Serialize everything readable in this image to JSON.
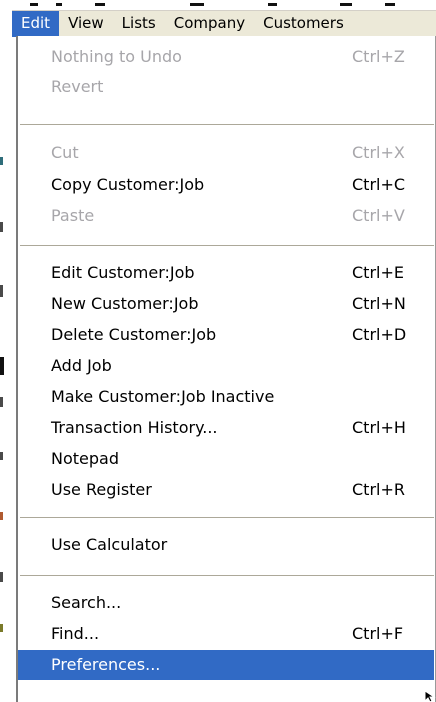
{
  "menubar": {
    "items": [
      {
        "label": "Edit",
        "active": true
      },
      {
        "label": "View",
        "active": false
      },
      {
        "label": "Lists",
        "active": false
      },
      {
        "label": "Company",
        "active": false
      },
      {
        "label": "Customers",
        "active": false
      }
    ]
  },
  "edit_menu": {
    "groups": [
      {
        "items": [
          {
            "label": "Nothing to Undo",
            "shortcut": "Ctrl+Z",
            "enabled": false
          },
          {
            "label": "Revert",
            "shortcut": "",
            "enabled": false
          }
        ]
      },
      {
        "items": [
          {
            "label": "Cut",
            "shortcut": "Ctrl+X",
            "enabled": false
          },
          {
            "label": "Copy Customer:Job",
            "shortcut": "Ctrl+C",
            "enabled": true
          },
          {
            "label": "Paste",
            "shortcut": "Ctrl+V",
            "enabled": false
          }
        ]
      },
      {
        "items": [
          {
            "label": "Edit Customer:Job",
            "shortcut": "Ctrl+E",
            "enabled": true
          },
          {
            "label": "New Customer:Job",
            "shortcut": "Ctrl+N",
            "enabled": true
          },
          {
            "label": "Delete Customer:Job",
            "shortcut": "Ctrl+D",
            "enabled": true
          },
          {
            "label": "Add Job",
            "shortcut": "",
            "enabled": true
          },
          {
            "label": "Make Customer:Job Inactive",
            "shortcut": "",
            "enabled": true
          },
          {
            "label": "Transaction History...",
            "shortcut": "Ctrl+H",
            "enabled": true
          },
          {
            "label": "Notepad",
            "shortcut": "",
            "enabled": true
          },
          {
            "label": "Use Register",
            "shortcut": "Ctrl+R",
            "enabled": true
          }
        ]
      },
      {
        "items": [
          {
            "label": "Use Calculator",
            "shortcut": "",
            "enabled": true
          }
        ]
      },
      {
        "items": [
          {
            "label": "Search...",
            "shortcut": "",
            "enabled": true
          },
          {
            "label": "Find...",
            "shortcut": "Ctrl+F",
            "enabled": true
          },
          {
            "label": "Preferences...",
            "shortcut": "",
            "enabled": true,
            "highlighted": true
          }
        ]
      }
    ]
  },
  "colors": {
    "menubar_bg": "#ece9d8",
    "highlight": "#316ac5",
    "disabled_text": "#a7a6aa",
    "separator": "#aca899"
  }
}
